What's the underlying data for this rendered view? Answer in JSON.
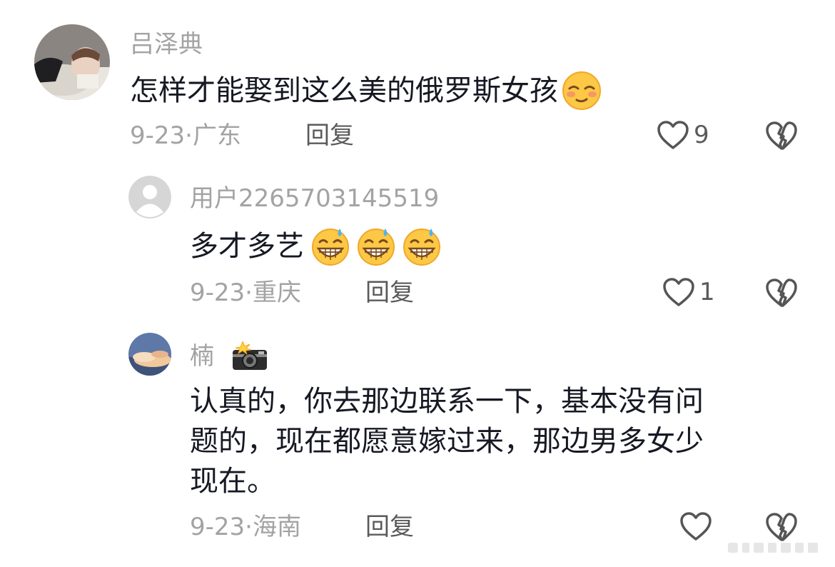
{
  "comments": [
    {
      "username": "吕泽典",
      "text": "怎样才能娶到这么美的俄罗斯女孩",
      "emoji": [
        "smug-face"
      ],
      "date": "9-23·广东",
      "reply_label": "回复",
      "likes": "9"
    },
    {
      "username": "用户2265703145519",
      "text": "多才多艺",
      "emoji": [
        "grinning-sweat-face",
        "grinning-sweat-face",
        "grinning-sweat-face"
      ],
      "date": "9-23·重庆",
      "reply_label": "回复",
      "likes": "1"
    },
    {
      "username": "楠",
      "badge_icon": "camera-flash-icon",
      "text_lines": [
        "认真的，你去那边联系一下，基本没有问",
        "题的，现在都愿意嫁过来，那边男多女少",
        "现在。"
      ],
      "date": "9-23·海南",
      "reply_label": "回复"
    }
  ]
}
